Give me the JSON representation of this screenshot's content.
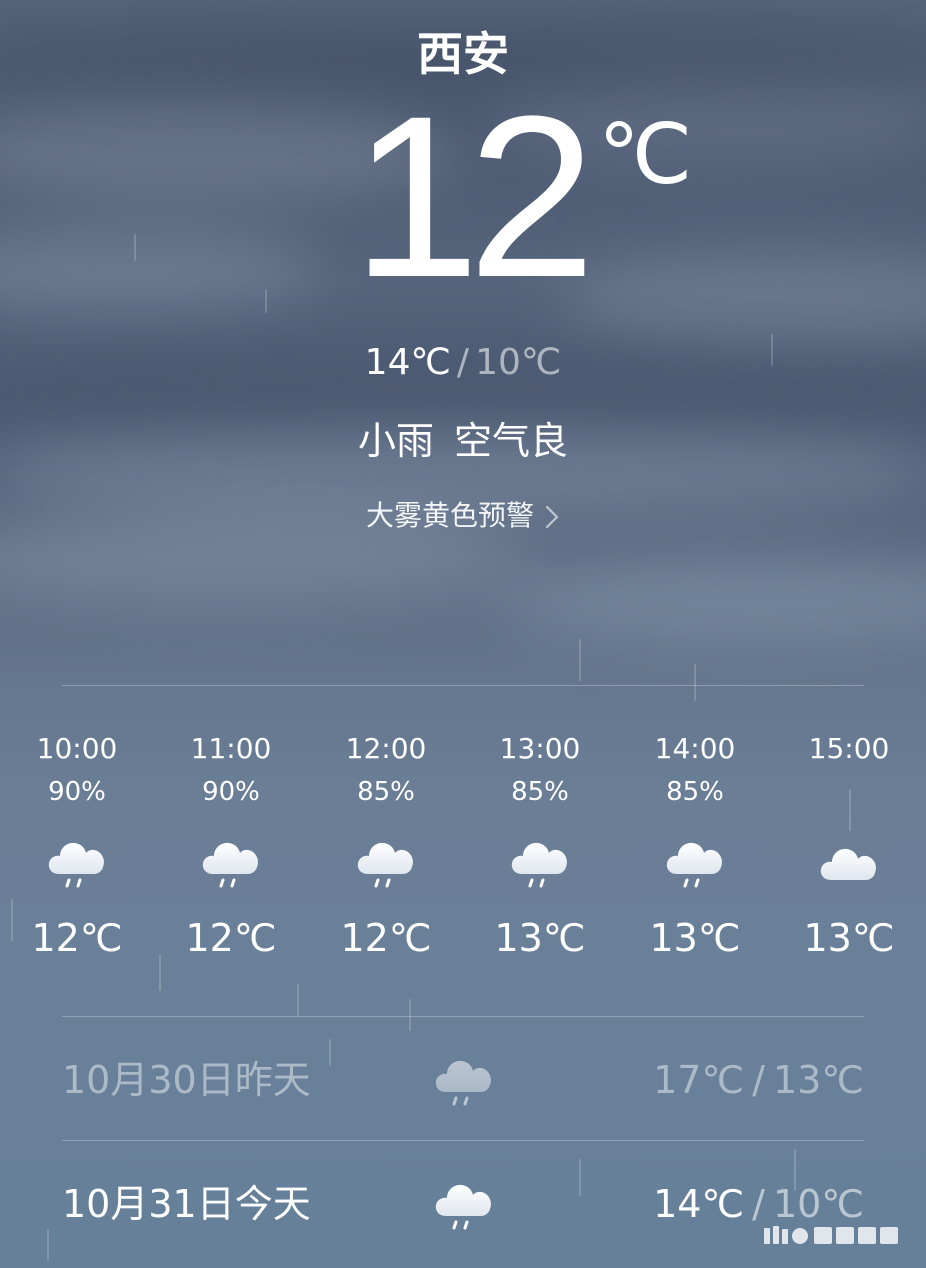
{
  "location": {
    "city": "西安"
  },
  "current": {
    "temperature": "12",
    "unit": "℃",
    "high": "14℃",
    "separator": "/",
    "low": "10℃",
    "condition": "小雨",
    "air_quality": "空气良",
    "alert": "大雾黄色预警"
  },
  "hourly": [
    {
      "time": "10:00",
      "precip": "90%",
      "icon": "cloud-rain-icon",
      "temp": "12℃"
    },
    {
      "time": "11:00",
      "precip": "90%",
      "icon": "cloud-rain-icon",
      "temp": "12℃"
    },
    {
      "time": "12:00",
      "precip": "85%",
      "icon": "cloud-rain-icon",
      "temp": "12℃"
    },
    {
      "time": "13:00",
      "precip": "85%",
      "icon": "cloud-rain-icon",
      "temp": "13℃"
    },
    {
      "time": "14:00",
      "precip": "85%",
      "icon": "cloud-rain-icon",
      "temp": "13℃"
    },
    {
      "time": "15:00",
      "precip": "",
      "icon": "cloud-icon",
      "temp": "13℃"
    }
  ],
  "daily": [
    {
      "label": "10月30日昨天",
      "icon": "cloud-rain-icon",
      "high": "17℃",
      "separator": "/",
      "low": "13℃"
    },
    {
      "label": "10月31日今天",
      "icon": "cloud-rain-icon",
      "high": "14℃",
      "separator": "/",
      "low": "10℃"
    }
  ],
  "colors": {
    "text": "#ffffff",
    "sky_top": "#4a5870",
    "sky_bottom": "#66809a"
  }
}
